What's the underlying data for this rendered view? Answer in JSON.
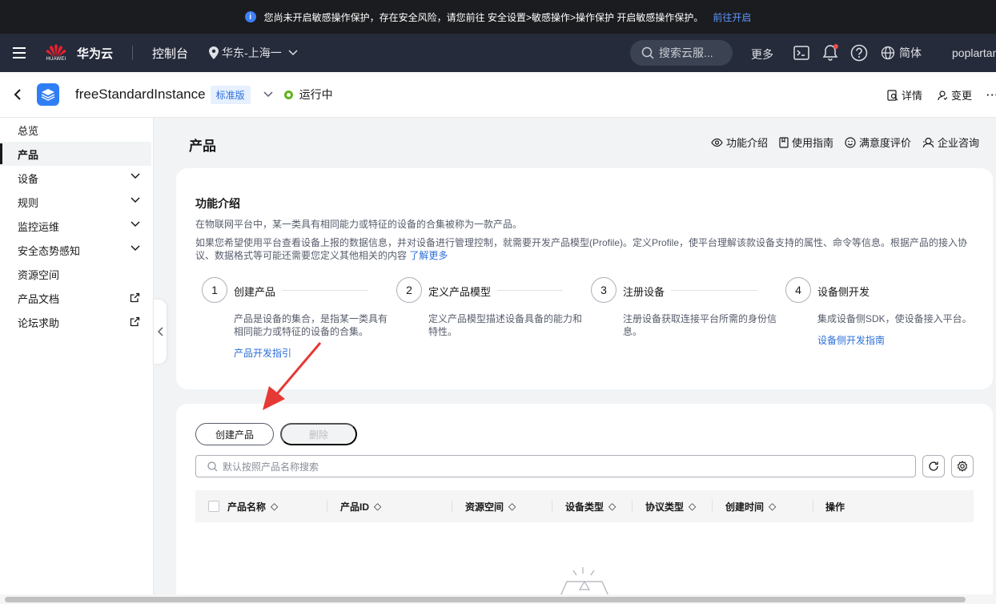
{
  "banner": {
    "text": "您尚未开启敏感操作保护，存在安全风险，请您前往 安全设置>敏感操作>操作保护 开启敏感操作保护。",
    "link": "前往开启"
  },
  "topnav": {
    "logo_text": "HUAWEI",
    "brand": "华为云",
    "console": "控制台",
    "region": "华东-上海一",
    "search_placeholder": "搜索云服...",
    "more": "更多",
    "lang": "简体",
    "user": "poplartan"
  },
  "instance": {
    "name": "freeStandardInstance",
    "edition": "标准版",
    "status": "运行中",
    "details": "详情",
    "change": "变更"
  },
  "sidebar": {
    "items": [
      {
        "label": "总览"
      },
      {
        "label": "产品"
      },
      {
        "label": "设备"
      },
      {
        "label": "规则"
      },
      {
        "label": "监控运维"
      },
      {
        "label": "安全态势感知"
      },
      {
        "label": "资源空间"
      },
      {
        "label": "产品文档"
      },
      {
        "label": "论坛求助"
      }
    ]
  },
  "page": {
    "title": "产品",
    "links": [
      "功能介绍",
      "使用指南",
      "满意度评价",
      "企业咨询"
    ]
  },
  "intro": {
    "title": "功能介绍",
    "p1": "在物联网平台中，某一类具有相同能力或特征的设备的合集被称为一款产品。",
    "p2": "如果您希望使用平台查看设备上报的数据信息，并对设备进行管理控制，就需要开发产品模型(Profile)。定义Profile，使平台理解该款设备支持的属性、命令等信息。根据产品的接入协议、数据格式等可能还需要您定义其他相关的内容",
    "p2_link": "了解更多",
    "steps": [
      {
        "num": "1",
        "title": "创建产品",
        "desc": "产品是设备的集合，是指某一类具有相同能力或特征的设备的合集。",
        "link": "产品开发指引"
      },
      {
        "num": "2",
        "title": "定义产品模型",
        "desc": "定义产品模型描述设备具备的能力和特性。",
        "link": ""
      },
      {
        "num": "3",
        "title": "注册设备",
        "desc": "注册设备获取连接平台所需的身份信息。",
        "link": ""
      },
      {
        "num": "4",
        "title": "设备侧开发",
        "desc": "集成设备侧SDK，使设备接入平台。",
        "link": "设备侧开发指南"
      }
    ]
  },
  "list": {
    "create_button": "创建产品",
    "delete_button": "删除",
    "search_placeholder": "默认按照产品名称搜索",
    "columns": [
      "产品名称",
      "产品ID",
      "资源空间",
      "设备类型",
      "协议类型",
      "创建时间",
      "操作"
    ]
  },
  "colors": {
    "accent": "#2d6fd8",
    "running": "#5fb320",
    "arrow": "#e53935"
  }
}
